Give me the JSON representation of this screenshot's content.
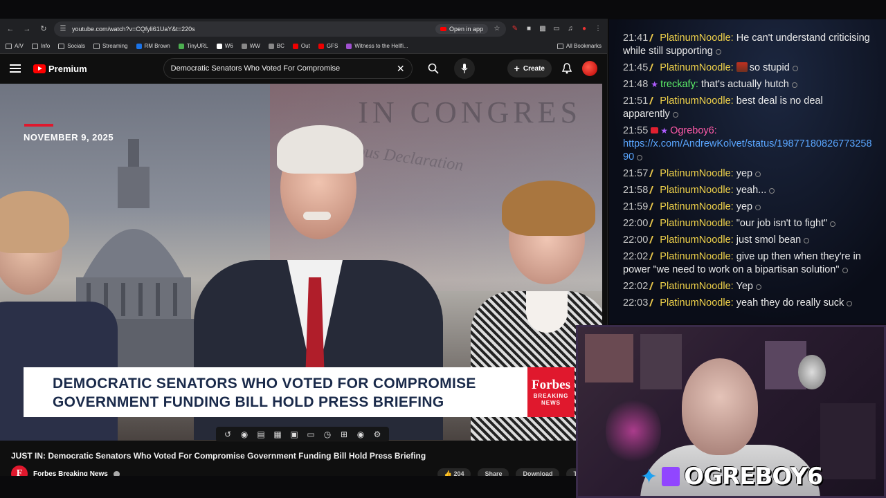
{
  "browser": {
    "url": "youtube.com/watch?v=CQfyli61UaY&t=220s",
    "open_in_app": "Open in app",
    "bookmarks": [
      "A/V",
      "Info",
      "Socials",
      "Streaming",
      "RM Brown",
      "TinyURL",
      "W6",
      "WW",
      "BC",
      "Out",
      "GFS",
      "Witness to the Hellfi..."
    ],
    "all_bookmarks": "All Bookmarks"
  },
  "youtube": {
    "logo_text": "Premium",
    "search_query": "Democratic Senators Who Voted For Compromise",
    "create_label": "Create",
    "date_overlay": "NOVEMBER 9, 2025",
    "lower_third": [
      "DEMOCRATIC SENATORS WHO VOTED FOR COMPROMISE",
      "GOVERNMENT FUNDING BILL HOLD PRESS BRIEFING"
    ],
    "forbes_name": "Forbes",
    "forbes_sub": "BREAKING NEWS",
    "video_title": "JUST IN: Democratic Senators Who Voted For Compromise Government Funding Bill Hold Press Briefing",
    "channel_name": "Forbes Breaking News",
    "actions": [
      "Share",
      "Download",
      "Thanks"
    ],
    "like_count": "204"
  },
  "chat": {
    "messages": [
      {
        "time": "21:41",
        "user": "PlatinumNoodle:",
        "text": "He can't understand criticising while still supporting",
        "color": "#f0d24a"
      },
      {
        "time": "21:45",
        "user": "PlatinumNoodle:",
        "text": "so stupid",
        "color": "#f0d24a",
        "emote": true
      },
      {
        "time": "21:48",
        "user": "treckafy:",
        "text": "that's actually hutch",
        "color": "#5ef26a",
        "star": true
      },
      {
        "time": "21:51",
        "user": "PlatinumNoodle:",
        "text": "best deal is no deal apparently",
        "color": "#f0d24a"
      },
      {
        "time": "21:55",
        "user": "Ogreboy6:",
        "text": "https://x.com/AndrewKolvet/status/1987718082677325890",
        "color": "#ff5aa8",
        "link": true
      },
      {
        "time": "21:57",
        "user": "PlatinumNoodle:",
        "text": "yep",
        "color": "#f0d24a"
      },
      {
        "time": "21:58",
        "user": "PlatinumNoodle:",
        "text": "yeah...",
        "color": "#f0d24a"
      },
      {
        "time": "21:59",
        "user": "PlatinumNoodle:",
        "text": "yep",
        "color": "#f0d24a"
      },
      {
        "time": "22:00",
        "user": "PlatinumNoodle:",
        "text": "\"our job isn't to fight\"",
        "color": "#f0d24a"
      },
      {
        "time": "22:00",
        "user": "PlatinumNoodle:",
        "text": "just smol bean",
        "color": "#f0d24a"
      },
      {
        "time": "22:02",
        "user": "PlatinumNoodle:",
        "text": "give up then when they're in power \"we need to work on a bipartisan solution\"",
        "color": "#f0d24a"
      },
      {
        "time": "22:02",
        "user": "PlatinumNoodle:",
        "text": "Yep",
        "color": "#f0d24a"
      },
      {
        "time": "22:03",
        "user": "PlatinumNoodle:",
        "text": "yeah they do really suck",
        "color": "#f0d24a"
      }
    ]
  },
  "stream": {
    "handle": "OGREBOY6"
  }
}
